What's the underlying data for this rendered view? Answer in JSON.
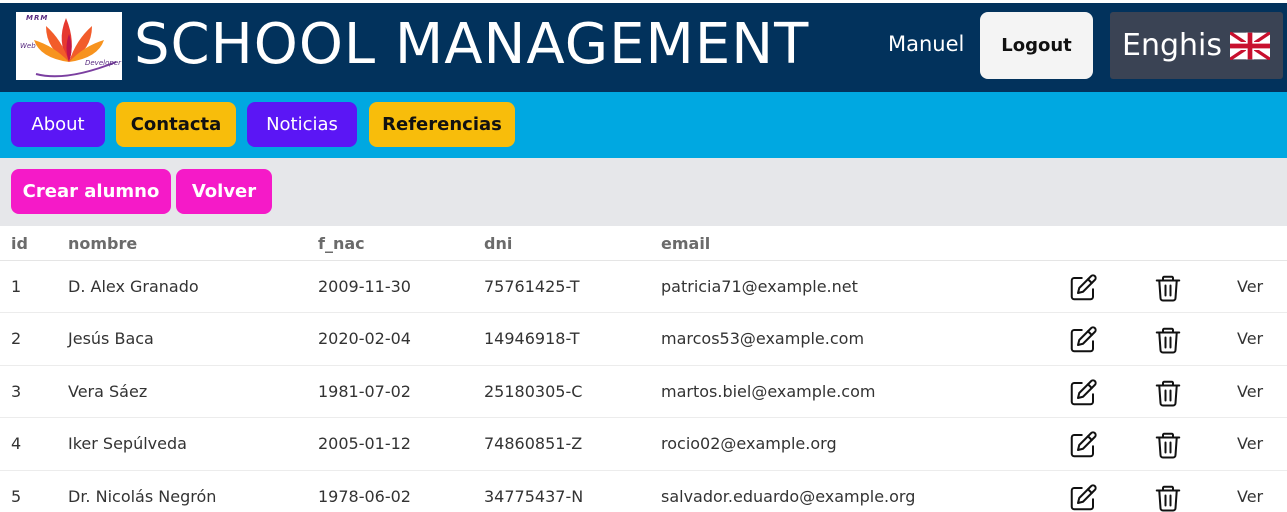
{
  "header": {
    "logo": {
      "top_text": "MRM",
      "left_text": "Web",
      "right_text": "Developer"
    },
    "title": "SCHOOL MANAGEMENT",
    "user": "Manuel",
    "logout_label": "Logout",
    "language_label": "Enghis",
    "language_flag_icon": "uk-flag-icon"
  },
  "nav": {
    "items": [
      {
        "label": "About",
        "color": "#5b16f5"
      },
      {
        "label": "Contacta",
        "color": "#f8bd0b"
      },
      {
        "label": "Noticias",
        "color": "#5b16f5"
      },
      {
        "label": "Referencias",
        "color": "#f8bd0b"
      }
    ]
  },
  "actions": {
    "create_label": "Crear alumno",
    "back_label": "Volver",
    "color": "#f51ac8"
  },
  "table": {
    "columns": [
      "id",
      "nombre",
      "f_nac",
      "dni",
      "email"
    ],
    "rows": [
      {
        "id": "1",
        "nombre": "D. Alex Granado",
        "f_nac": "2009-11-30",
        "dni": "75761425-T",
        "email": "patricia71@example.net",
        "ver": "Ver"
      },
      {
        "id": "2",
        "nombre": "Jesús Baca",
        "f_nac": "2020-02-04",
        "dni": "14946918-T",
        "email": "marcos53@example.com",
        "ver": "Ver"
      },
      {
        "id": "3",
        "nombre": "Vera Sáez",
        "f_nac": "1981-07-02",
        "dni": "25180305-C",
        "email": "martos.biel@example.com",
        "ver": "Ver"
      },
      {
        "id": "4",
        "nombre": "Iker Sepúlveda",
        "f_nac": "2005-01-12",
        "dni": "74860851-Z",
        "email": "rocio02@example.org",
        "ver": "Ver"
      },
      {
        "id": "5",
        "nombre": "Dr. Nicolás Negrón",
        "f_nac": "1978-06-02",
        "dni": "34775437-N",
        "email": "salvador.eduardo@example.org",
        "ver": "Ver"
      }
    ],
    "edit_icon": "edit-icon",
    "delete_icon": "trash-icon"
  },
  "colors": {
    "header_bg": "#02325c",
    "nav_bg": "#00a8e1",
    "actions_bg": "#e6e7ea"
  }
}
